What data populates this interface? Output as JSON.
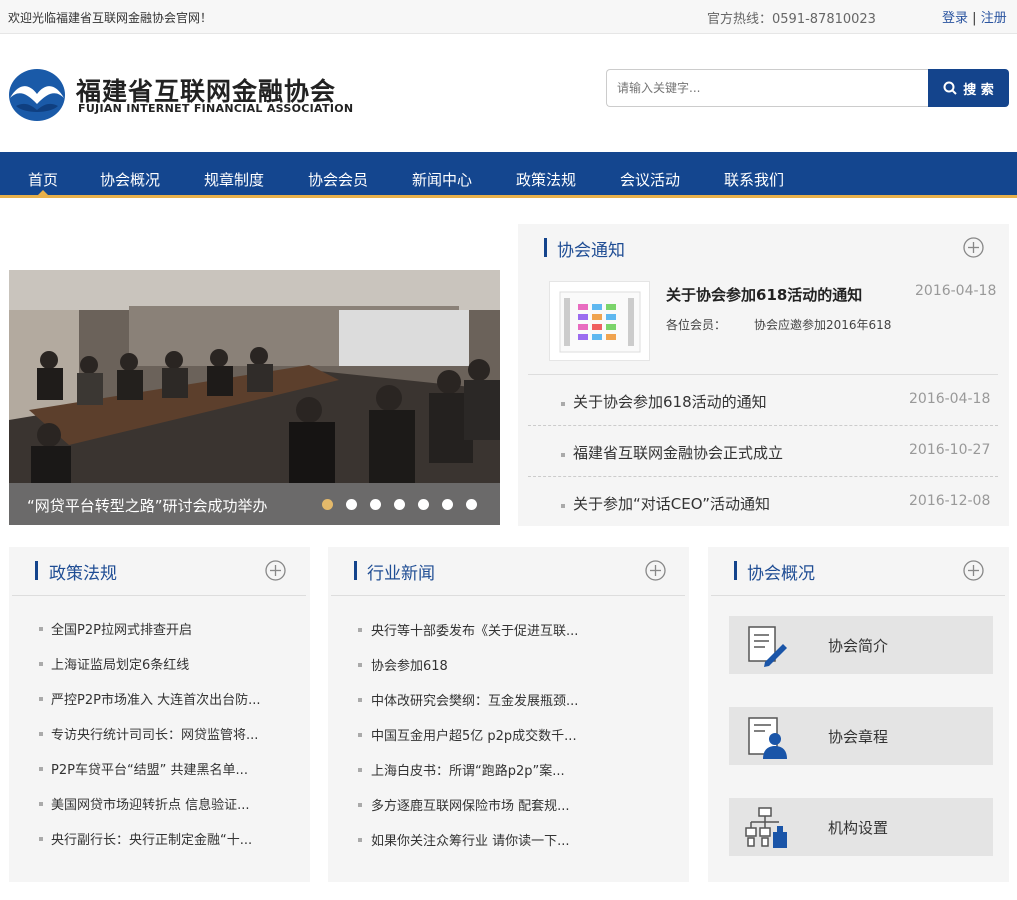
{
  "topbar": {
    "welcome": "欢迎光临福建省互联网金融协会官网！",
    "hotline": "官方热线：0591-87810023",
    "login": "登录",
    "separator": "|",
    "register": "注册"
  },
  "header": {
    "logo_cn": "福建省互联网金融协会",
    "logo_en": "FUJIAN INTERNET FINANCIAL ASSOCIATION",
    "search_placeholder": "请输入关键字...",
    "search_button": "搜 索"
  },
  "nav": {
    "items": [
      "首页",
      "协会概况",
      "规章制度",
      "协会会员",
      "新闻中心",
      "政策法规",
      "会议活动",
      "联系我们"
    ],
    "active": "首页"
  },
  "slider": {
    "caption": "“网贷平台转型之路”研讨会成功举办",
    "dot_count": 7,
    "active_dot": 1
  },
  "notice": {
    "title": "协会通知",
    "featured": {
      "title": "关于协会参加618活动的通知",
      "date": "2016-04-18",
      "sub_label": "各位会员：",
      "sub_text": "协会应邀参加2016年618"
    },
    "items": [
      {
        "title": "关于协会参加618活动的通知",
        "date": "2016-04-18"
      },
      {
        "title": "福建省互联网金融协会正式成立",
        "date": "2016-10-27"
      },
      {
        "title": "关于参加“对话CEO”活动通知",
        "date": "2016-12-08"
      }
    ]
  },
  "policy": {
    "title": "政策法规",
    "items": [
      "全国P2P拉网式排查开启",
      "上海证监局划定6条红线",
      "严控P2P市场准入 大连首次出台防...",
      "专访央行统计司司长：网贷监管将...",
      "P2P车贷平台“结盟” 共建黑名单...",
      "美国网贷市场迎转折点 信息验证...",
      "央行副行长：央行正制定金融“十..."
    ]
  },
  "industry": {
    "title": "行业新闻",
    "items": [
      "央行等十部委发布《关于促进互联...",
      "协会参加618",
      "中体改研究会樊纲：互金发展瓶颈...",
      "中国互金用户超5亿 p2p成交数千...",
      "上海白皮书：所谓“跑路p2p”案...",
      "多方逐鹿互联网保险市场 配套规...",
      "如果你关注众筹行业 请你读一下..."
    ]
  },
  "overview": {
    "title": "协会概况",
    "buttons": [
      {
        "label": "协会简介",
        "icon": "document-edit-icon"
      },
      {
        "label": "协会章程",
        "icon": "person-document-icon"
      },
      {
        "label": "机构设置",
        "icon": "org-chart-icon"
      }
    ]
  },
  "colors": {
    "brand_blue": "#14468f",
    "accent_gold": "#e8b04a",
    "panel_bg": "#f5f5f5"
  }
}
